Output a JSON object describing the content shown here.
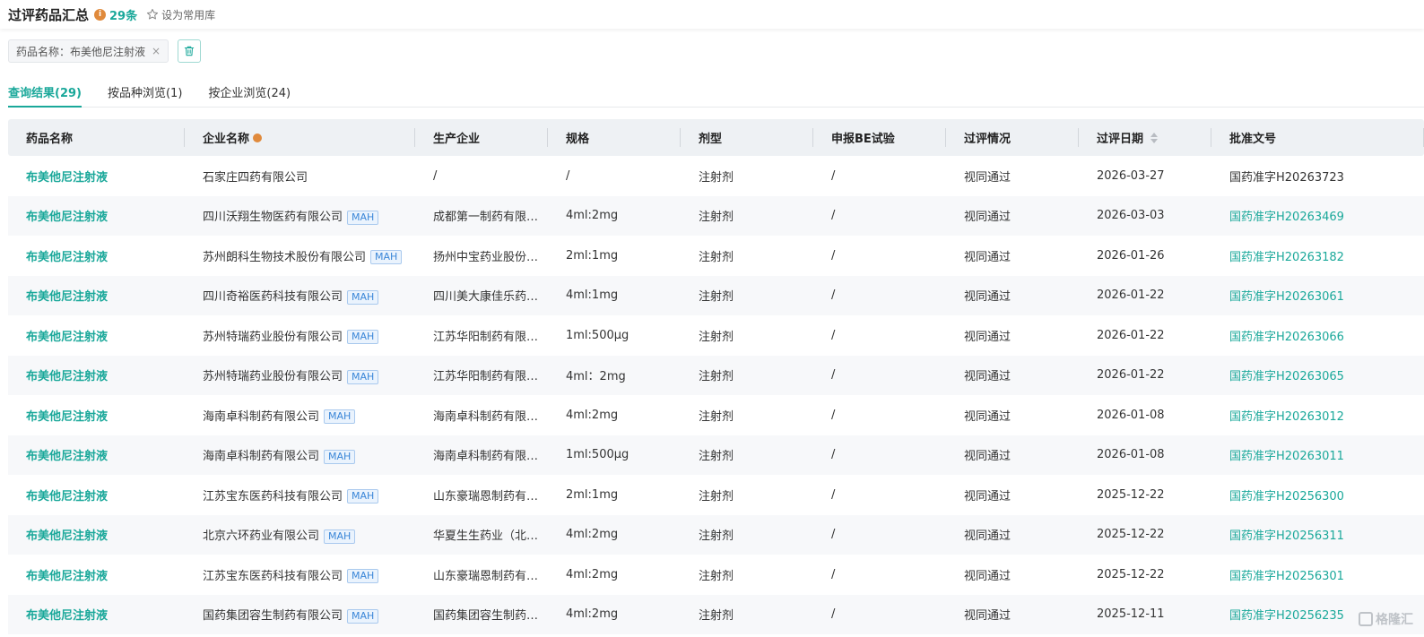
{
  "header": {
    "title": "过评药品汇总",
    "info_icon": "i",
    "count": "29条",
    "favorite_label": "设为常用库"
  },
  "filter": {
    "tag_label": "药品名称：布美他尼注射液",
    "close_glyph": "×"
  },
  "tabs": [
    {
      "label": "查询结果(29)",
      "active": true
    },
    {
      "label": "按品种浏览(1)",
      "active": false
    },
    {
      "label": "按企业浏览(24)",
      "active": false
    }
  ],
  "table": {
    "columns": [
      "药品名称",
      "企业名称",
      "生产企业",
      "规格",
      "剂型",
      "申报BE试验",
      "过评情况",
      "过评日期",
      "批准文号"
    ],
    "mah_label": "MAH",
    "rows": [
      {
        "drug": "布美他尼注射液",
        "company": "石家庄四药有限公司",
        "mah": false,
        "producer": "/",
        "spec": "/",
        "form": "注射剂",
        "be": "/",
        "status": "视同通过",
        "date": "2026-03-27",
        "approval": "国药准字H20263723",
        "approval_link": false
      },
      {
        "drug": "布美他尼注射液",
        "company": "四川沃翔生物医药有限公司",
        "mah": true,
        "producer": "成都第一制药有限…",
        "spec": "4ml:2mg",
        "form": "注射剂",
        "be": "/",
        "status": "视同通过",
        "date": "2026-03-03",
        "approval": "国药准字H20263469",
        "approval_link": true
      },
      {
        "drug": "布美他尼注射液",
        "company": "苏州朗科生物技术股份有限公司",
        "mah": true,
        "producer": "扬州中宝药业股份…",
        "spec": "2ml:1mg",
        "form": "注射剂",
        "be": "/",
        "status": "视同通过",
        "date": "2026-01-26",
        "approval": "国药准字H20263182",
        "approval_link": true
      },
      {
        "drug": "布美他尼注射液",
        "company": "四川奇裕医药科技有限公司",
        "mah": true,
        "producer": "四川美大康佳乐药…",
        "spec": "4ml:1mg",
        "form": "注射剂",
        "be": "/",
        "status": "视同通过",
        "date": "2026-01-22",
        "approval": "国药准字H20263061",
        "approval_link": true
      },
      {
        "drug": "布美他尼注射液",
        "company": "苏州特瑞药业股份有限公司",
        "mah": true,
        "producer": "江苏华阳制药有限…",
        "spec": "1ml:500μg",
        "form": "注射剂",
        "be": "/",
        "status": "视同通过",
        "date": "2026-01-22",
        "approval": "国药准字H20263066",
        "approval_link": true
      },
      {
        "drug": "布美他尼注射液",
        "company": "苏州特瑞药业股份有限公司",
        "mah": true,
        "producer": "江苏华阳制药有限…",
        "spec": "4ml：2mg",
        "form": "注射剂",
        "be": "/",
        "status": "视同通过",
        "date": "2026-01-22",
        "approval": "国药准字H20263065",
        "approval_link": true
      },
      {
        "drug": "布美他尼注射液",
        "company": "海南卓科制药有限公司",
        "mah": true,
        "producer": "海南卓科制药有限…",
        "spec": "4ml:2mg",
        "form": "注射剂",
        "be": "/",
        "status": "视同通过",
        "date": "2026-01-08",
        "approval": "国药准字H20263012",
        "approval_link": true
      },
      {
        "drug": "布美他尼注射液",
        "company": "海南卓科制药有限公司",
        "mah": true,
        "producer": "海南卓科制药有限…",
        "spec": "1ml:500μg",
        "form": "注射剂",
        "be": "/",
        "status": "视同通过",
        "date": "2026-01-08",
        "approval": "国药准字H20263011",
        "approval_link": true
      },
      {
        "drug": "布美他尼注射液",
        "company": "江苏宝东医药科技有限公司",
        "mah": true,
        "producer": "山东豪瑞恩制药有…",
        "spec": "2ml:1mg",
        "form": "注射剂",
        "be": "/",
        "status": "视同通过",
        "date": "2025-12-22",
        "approval": "国药准字H20256300",
        "approval_link": true
      },
      {
        "drug": "布美他尼注射液",
        "company": "北京六环药业有限公司",
        "mah": true,
        "producer": "华夏生生药业（北…",
        "spec": "4ml:2mg",
        "form": "注射剂",
        "be": "/",
        "status": "视同通过",
        "date": "2025-12-22",
        "approval": "国药准字H20256311",
        "approval_link": true
      },
      {
        "drug": "布美他尼注射液",
        "company": "江苏宝东医药科技有限公司",
        "mah": true,
        "producer": "山东豪瑞恩制药有…",
        "spec": "4ml:2mg",
        "form": "注射剂",
        "be": "/",
        "status": "视同通过",
        "date": "2025-12-22",
        "approval": "国药准字H20256301",
        "approval_link": true
      },
      {
        "drug": "布美他尼注射液",
        "company": "国药集团容生制药有限公司",
        "mah": true,
        "producer": "国药集团容生制药…",
        "spec": "4ml:2mg",
        "form": "注射剂",
        "be": "/",
        "status": "视同通过",
        "date": "2025-12-11",
        "approval": "国药准字H20256235",
        "approval_link": true
      }
    ]
  },
  "watermark": {
    "text": "格隆汇"
  },
  "colors": {
    "accent": "#1aa89a",
    "info": "#e08a3c",
    "mah_blue": "#3a86d8"
  }
}
